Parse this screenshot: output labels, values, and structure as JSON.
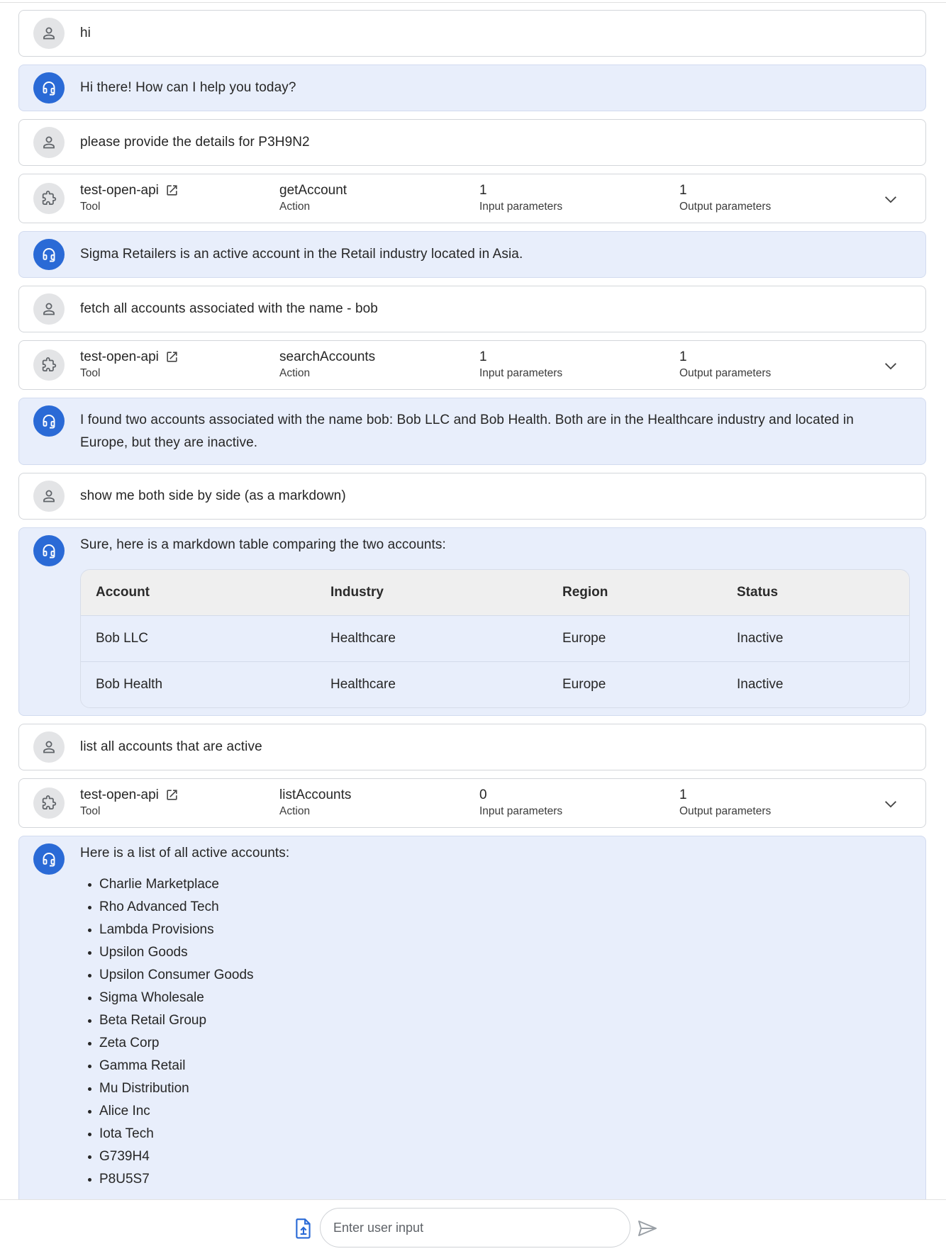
{
  "conversation": {
    "m1": {
      "role": "user",
      "text": "hi"
    },
    "m2": {
      "role": "agent",
      "text": "Hi there! How can I help you today?"
    },
    "m3": {
      "role": "user",
      "text": "please provide the details for P3H9N2"
    },
    "m4": {
      "role": "tool",
      "tool_name": "test-open-api",
      "tool_label": "Tool",
      "action_name": "getAccount",
      "action_label": "Action",
      "input_count": "1",
      "input_label": "Input parameters",
      "output_count": "1",
      "output_label": "Output parameters"
    },
    "m5": {
      "role": "agent",
      "text": "Sigma Retailers is an active account in the Retail industry located in Asia."
    },
    "m6": {
      "role": "user",
      "text": "fetch all accounts associated with the name - bob"
    },
    "m7": {
      "role": "tool",
      "tool_name": "test-open-api",
      "tool_label": "Tool",
      "action_name": "searchAccounts",
      "action_label": "Action",
      "input_count": "1",
      "input_label": "Input parameters",
      "output_count": "1",
      "output_label": "Output parameters"
    },
    "m8": {
      "role": "agent",
      "text": "I found two accounts associated with the name bob: Bob LLC and Bob Health. Both are in the Healthcare industry and located in Europe, but they are inactive."
    },
    "m9": {
      "role": "user",
      "text": "show me both side by side (as a markdown)"
    },
    "m10": {
      "role": "agent",
      "text": "Sure, here is a markdown table comparing the two accounts:",
      "table": {
        "headers": [
          "Account",
          "Industry",
          "Region",
          "Status"
        ],
        "rows": [
          [
            "Bob LLC",
            "Healthcare",
            "Europe",
            "Inactive"
          ],
          [
            "Bob Health",
            "Healthcare",
            "Europe",
            "Inactive"
          ]
        ]
      }
    },
    "m11": {
      "role": "user",
      "text": "list all accounts that are active"
    },
    "m12": {
      "role": "tool",
      "tool_name": "test-open-api",
      "tool_label": "Tool",
      "action_name": "listAccounts",
      "action_label": "Action",
      "input_count": "0",
      "input_label": "Input parameters",
      "output_count": "1",
      "output_label": "Output parameters"
    },
    "m13": {
      "role": "agent",
      "text": "Here is a list of all active accounts:",
      "items": [
        "Charlie Marketplace",
        "Rho Advanced Tech",
        "Lambda Provisions",
        "Upsilon Goods",
        "Upsilon Consumer Goods",
        "Sigma Wholesale",
        "Beta Retail Group",
        "Zeta Corp",
        "Gamma Retail",
        "Mu Distribution",
        "Alice Inc",
        "Iota Tech",
        "G739H4",
        "P8U5S7"
      ]
    }
  },
  "composer": {
    "placeholder": "Enter user input",
    "value": ""
  },
  "icons": {
    "user_avatar": "person-icon",
    "agent_avatar": "headset-icon",
    "tool_avatar": "extension-icon",
    "external_link": "open-in-new-icon",
    "expand": "chevron-down-icon",
    "upload": "upload-file-icon",
    "send": "send-icon"
  },
  "colors": {
    "agent_bubble": "#e8eefb",
    "agent_avatar": "#2a6ad6",
    "user_avatar": "#e3e4e6",
    "border": "#d3d6da"
  }
}
